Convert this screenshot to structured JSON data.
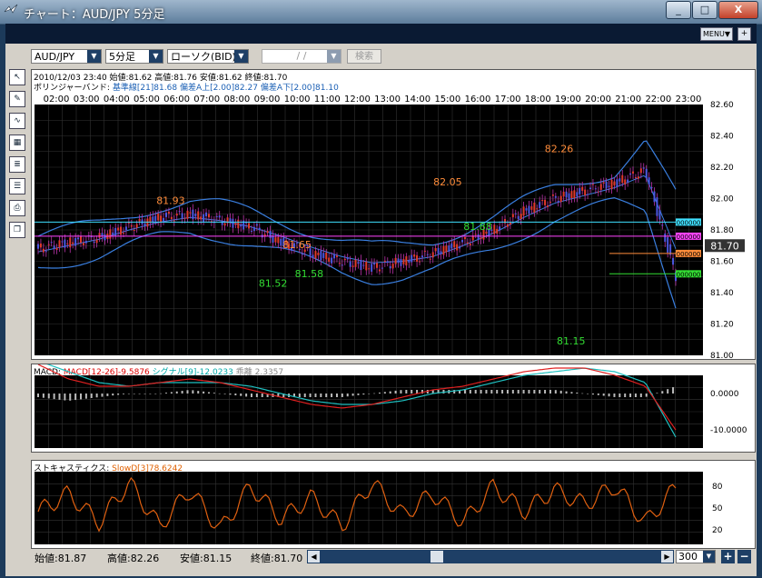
{
  "window": {
    "title": "チャート：AUD/JPY 5分足",
    "minimize": "_",
    "maximize": "□",
    "close": "X"
  },
  "appbar": {
    "menu": "MENU▼",
    "corner": "+"
  },
  "toolbar": {
    "symbol": "AUD/JPY",
    "timeframe": "5分足",
    "chart_type": "ローソク(BID)",
    "date_placeholder": "/ /",
    "search": "検索"
  },
  "left_tools": [
    "cursor-tool-icon",
    "pencil-icon",
    "fibonacci-icon",
    "calendar-icon",
    "list-icon",
    "notes-icon",
    "print-icon",
    "window-icon"
  ],
  "main_chart": {
    "ohlc_line": "2010/12/03 23:40  始値:81.62  高値:81.76  安値:81.62  終値:81.70",
    "bb_label": "ボリンジャーバンド:",
    "bb_base": "基準線[21]81.68",
    "bb_upper": "偏差A上[2.00]82.27",
    "bb_lower": "偏差A下[2.00]81.10",
    "current_price": "81.70",
    "annotations": [
      {
        "text": "81.93",
        "color": "#ff8c3a"
      },
      {
        "text": "81.65",
        "color": "#ff8c3a"
      },
      {
        "text": "82.05",
        "color": "#ff8c3a"
      },
      {
        "text": "82.26",
        "color": "#ff8c3a"
      },
      {
        "text": "81.52",
        "color": "#33dd33"
      },
      {
        "text": "81.58",
        "color": "#33dd33"
      },
      {
        "text": "81.88",
        "color": "#33dd33"
      },
      {
        "text": "81.15",
        "color": "#33dd33"
      }
    ],
    "hline_tags": [
      {
        "text": "000000",
        "color": "#3fe0ff"
      },
      {
        "text": "000000",
        "color": "#ff44ff"
      },
      {
        "text": "000000",
        "color": "#ff8c3a"
      },
      {
        "text": "000000",
        "color": "#33dd33"
      }
    ]
  },
  "chart_data": [
    {
      "type": "line",
      "title": "AUD/JPY 5分足",
      "x": [
        "02:00",
        "03:00",
        "04:00",
        "05:00",
        "06:00",
        "07:00",
        "08:00",
        "09:00",
        "10:00",
        "11:00",
        "12:00",
        "13:00",
        "14:00",
        "15:00",
        "16:00",
        "17:00",
        "18:00",
        "19:00",
        "20:00",
        "21:00",
        "22:00",
        "23:00"
      ],
      "series": [
        {
          "name": "ローソク(BID)",
          "values": [
            81.68,
            81.72,
            81.75,
            81.82,
            81.88,
            81.9,
            81.86,
            81.82,
            81.72,
            81.65,
            81.6,
            81.56,
            81.6,
            81.65,
            81.72,
            81.8,
            81.92,
            82.0,
            82.05,
            82.1,
            82.18,
            81.5
          ]
        },
        {
          "name": "基準線[21]",
          "values": [
            81.66,
            81.7,
            81.74,
            81.8,
            81.85,
            81.88,
            81.86,
            81.82,
            81.76,
            81.69,
            81.63,
            81.59,
            81.6,
            81.63,
            81.7,
            81.78,
            81.88,
            81.97,
            82.02,
            82.07,
            82.15,
            81.68
          ]
        }
      ],
      "ylim": [
        81.0,
        82.6
      ],
      "y_ticks": [
        "82.60",
        "82.40",
        "82.20",
        "82.00",
        "81.80",
        "81.60",
        "81.40",
        "81.20",
        "81.00"
      ],
      "grid": true
    },
    {
      "type": "line",
      "title": "MACD",
      "series": [
        {
          "name": "MACD[12-26]",
          "values": [
            8,
            4,
            2,
            2,
            3,
            4,
            3,
            1,
            -1,
            -3,
            -4,
            -3,
            -1,
            1,
            2,
            4,
            6,
            7,
            7,
            5,
            2,
            -10
          ]
        },
        {
          "name": "シグナル[9]",
          "values": [
            9,
            6,
            3,
            2,
            3,
            3,
            3,
            2,
            0,
            -2,
            -3,
            -3,
            -2,
            0,
            1,
            3,
            5,
            6,
            7,
            6,
            3,
            -12
          ]
        }
      ],
      "ylim": [
        -15,
        5
      ],
      "y_ticks": [
        "0.0000",
        "-10.0000"
      ]
    },
    {
      "type": "line",
      "title": "ストキャスティクス",
      "series": [
        {
          "name": "SlowD[3]",
          "values": [
            45,
            70,
            30,
            85,
            25,
            75,
            20,
            80,
            35,
            65,
            25,
            85,
            40,
            70,
            30,
            80,
            45,
            75,
            55,
            80,
            30,
            78
          ]
        }
      ],
      "ylim": [
        0,
        100
      ],
      "y_ticks": [
        "80",
        "50",
        "20"
      ]
    }
  ],
  "macd_panel": {
    "label": "MACD:",
    "macd": "MACD[12-26]-9.5876",
    "signal": "シグナル[9]-12.0233",
    "diff": "乖離 2.3357"
  },
  "stoch_panel": {
    "label": "ストキャスティクス:",
    "slowd": "SlowD[3]78.6242"
  },
  "bottom": {
    "open": "始値:81.87",
    "high": "高値:82.26",
    "low": "安値:81.15",
    "close": "終値:81.70",
    "bars": "300",
    "plus": "+",
    "minus": "−"
  }
}
